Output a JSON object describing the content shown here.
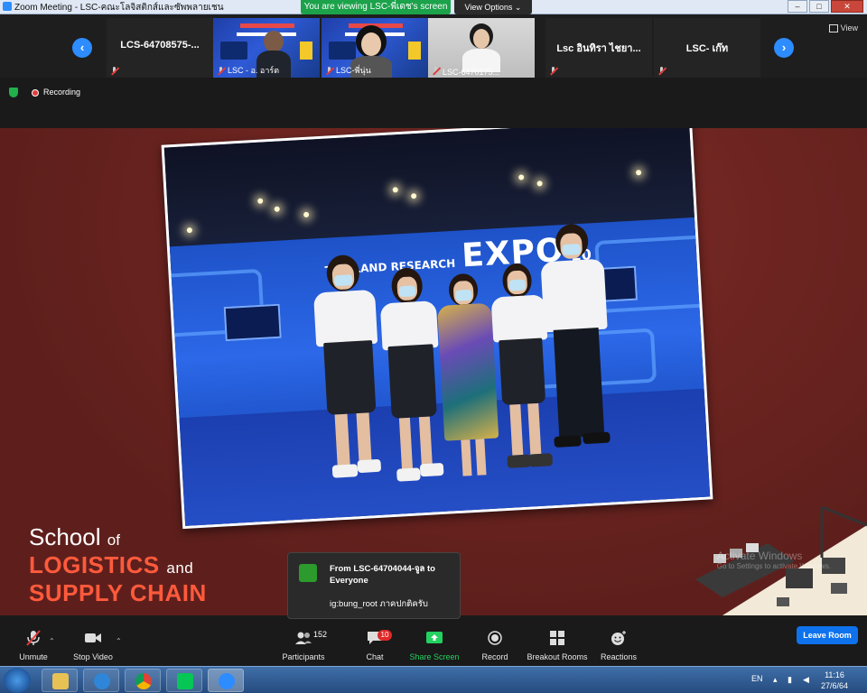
{
  "window": {
    "title": "Zoom Meeting - LSC-คณะโลจิสติกส์และซัพพลายเชน",
    "share_banner": "You are viewing LSC-พี่เดช's screen",
    "view_options": "View Options ⌄"
  },
  "gallery": {
    "prev_arrow": "‹",
    "next_arrow": "›",
    "view_label": "View",
    "tiles": [
      {
        "name": "LCS-64708575-...",
        "type": "name"
      },
      {
        "name": "LSC - อ. อาร์ต",
        "type": "video"
      },
      {
        "name": "LSC-พี่นุ่น",
        "type": "video"
      },
      {
        "name": "LSC-6470175...",
        "type": "video"
      },
      {
        "name": "Lsc อินทิรา ไชยา...",
        "type": "name"
      },
      {
        "name": "LSC- เก๊ท",
        "type": "name"
      }
    ]
  },
  "status": {
    "recording_label": "Recording"
  },
  "shared_content": {
    "expo_logo_prefix": "THAILAND RESEARCH",
    "expo_logo_main": "EXPO",
    "expo_logo_year": "20",
    "school_line1_a": "School",
    "school_line1_b": "of",
    "school_line2": "LOGISTICS",
    "school_line2_b": "and",
    "school_line3": "SUPPLY CHAIN",
    "watermark_line1": "Activate Windows",
    "watermark_line2": "Go to Settings to activate Windows."
  },
  "chat_toast": {
    "from": "From LSC-64704044-จูล to Everyone",
    "message": "ig:bung_root ภาคปกติครับ"
  },
  "toolbar": {
    "unmute": "Unmute",
    "stop_video": "Stop Video",
    "participants": "Participants",
    "participants_count": "152",
    "chat": "Chat",
    "chat_badge": "10",
    "share_screen": "Share Screen",
    "record": "Record",
    "breakout_rooms": "Breakout Rooms",
    "reactions": "Reactions",
    "leave_room": "Leave Room"
  },
  "taskbar": {
    "language": "EN",
    "time": "11:16",
    "date": "27/6/64"
  },
  "colors": {
    "zoom_blue": "#2d8cff",
    "share_green": "#1ba24a",
    "stage_maroon": "#6b2420",
    "logo_orange": "#ff5a3c"
  }
}
